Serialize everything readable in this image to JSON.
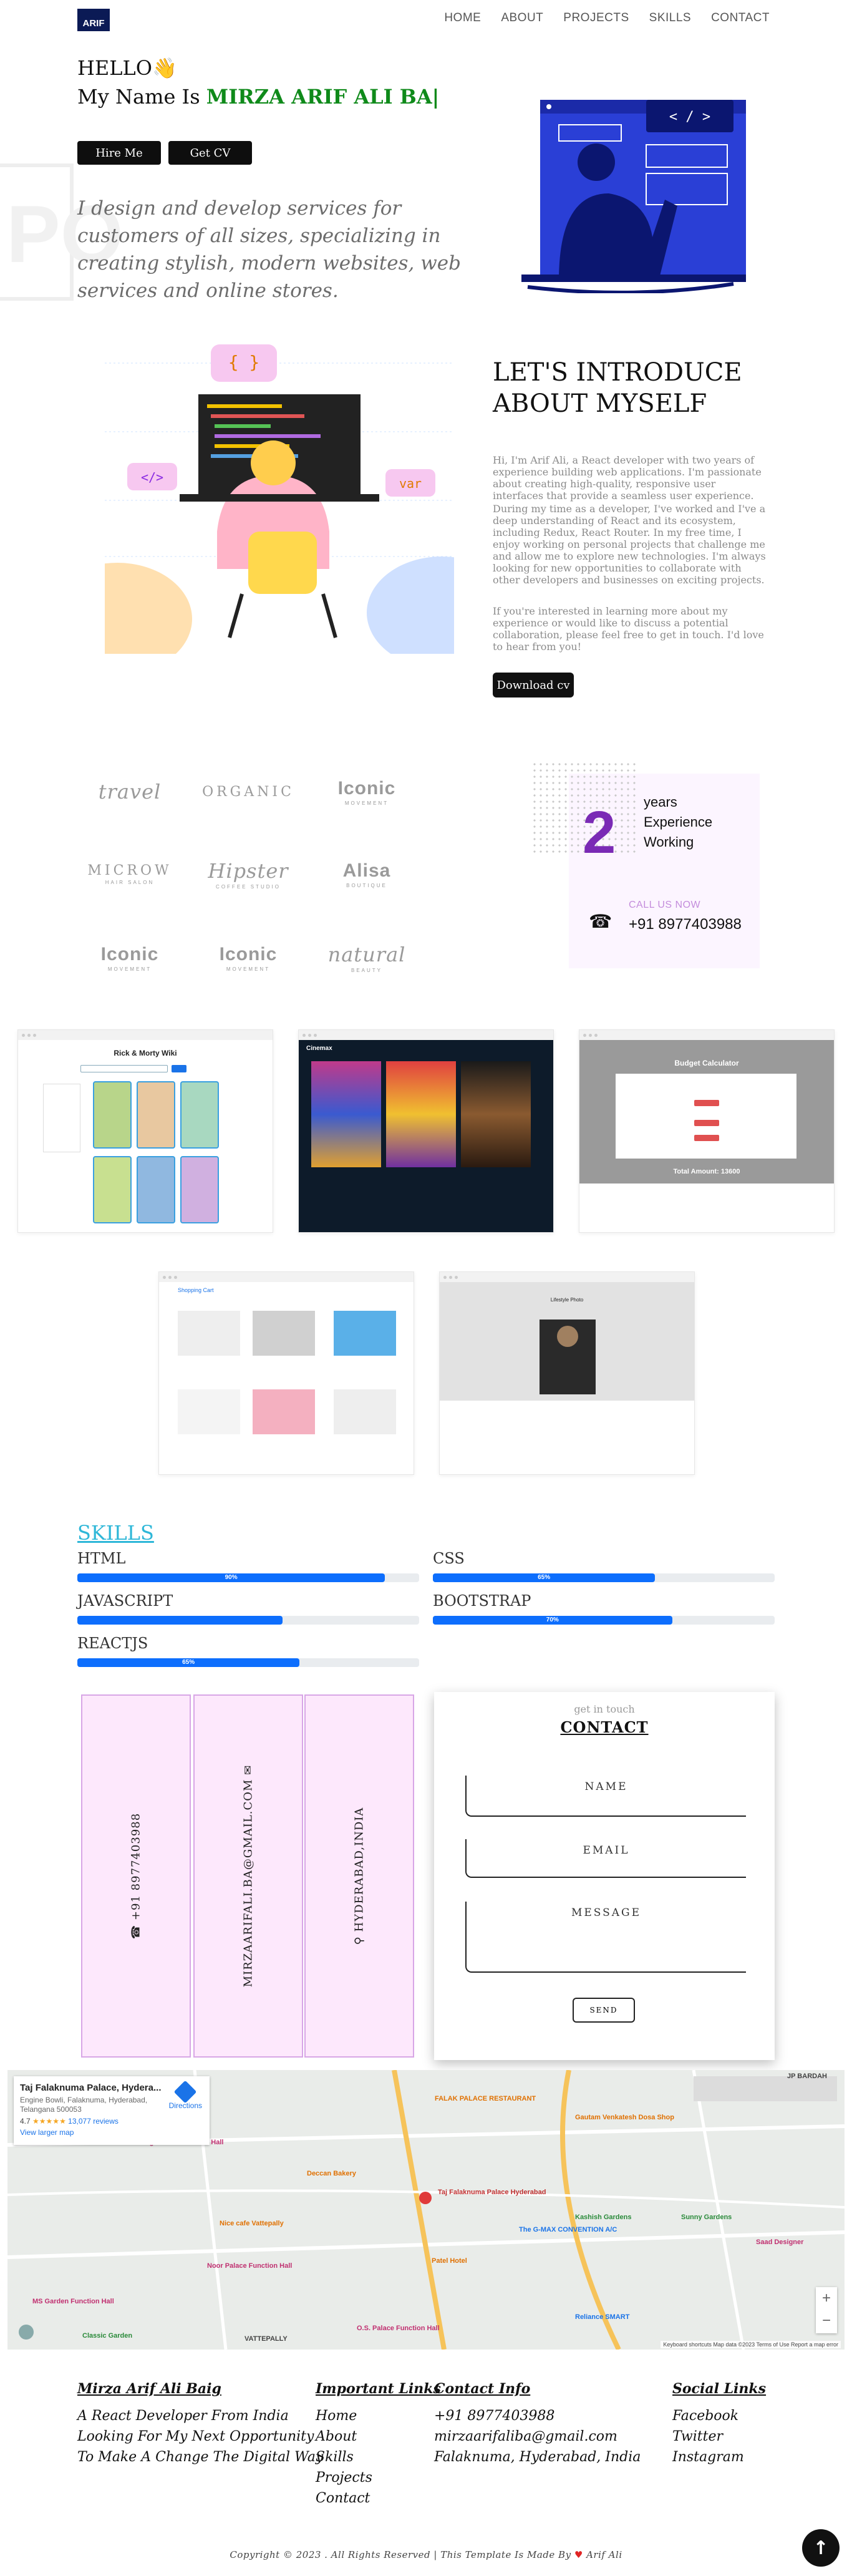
{
  "nav": {
    "logo": "ARIF",
    "links": [
      "HOME",
      "ABOUT",
      "PROJECTS",
      "SKILLS",
      "CONTACT"
    ]
  },
  "hero": {
    "hello": "HELLO",
    "name_prefix": "My Name Is ",
    "name": "MIRZA ARIF ALI BA|",
    "hire_button": "Hire Me",
    "cv_button": "Get CV",
    "ghost_text": "PO",
    "description": "I design and develop services for customers of all sizes, specializing in creating stylish, modern websites, web services and online stores.",
    "art_code": "< / >"
  },
  "about": {
    "title": "LET'S INTRODUCE ABOUT MYSELF",
    "p1": "Hi, I'm Arif Ali, a React developer with two years of experience building web applications. I'm passionate about creating high-quality, responsive user interfaces that provide a seamless user experience.",
    "p2": "During my time as a developer, I've worked and I've a deep understanding of React and its ecosystem, including Redux, React Router. In my free time, I enjoy working on personal projects that challenge me and allow me to explore new technologies. I'm always looking for new opportunities to collaborate with other developers and businesses on exciting projects.",
    "p3": "If you're interested in learning more about my experience or would like to discuss a potential collaboration, please feel free to get in touch. I'd love to hear from you!",
    "button": "Download cv",
    "art_tags": [
      "{ }",
      "</>",
      "var"
    ]
  },
  "brands": [
    {
      "name": "travel",
      "sub": ""
    },
    {
      "name": "ORGANIC",
      "sub": ""
    },
    {
      "name": "Iconic",
      "sub": "MOVEMENT"
    },
    {
      "name": "MICROW",
      "sub": "HAIR SALON"
    },
    {
      "name": "Hipster",
      "sub": "COFFEE STUDIO"
    },
    {
      "name": "Alisa",
      "sub": "BOUTIQUE"
    },
    {
      "name": "Iconic",
      "sub": "MOVEMENT"
    },
    {
      "name": "Iconic",
      "sub": "MOVEMENT"
    },
    {
      "name": "natural",
      "sub": "BEAUTY"
    }
  ],
  "experience": {
    "number": "2",
    "label_lines": [
      "years",
      "Experience",
      "Working"
    ],
    "call_label": "CALL US NOW",
    "phone": "+91 8977403988"
  },
  "projects": [
    {
      "title": "Rick & Morty Wiki"
    },
    {
      "title": "Cinemax"
    },
    {
      "title": "Budget Calculator",
      "total": "Total Amount: 13600"
    },
    {
      "title": "Shopping Cart"
    },
    {
      "title": "Lifestyle Photo"
    }
  ],
  "skills": {
    "title": "SKILLS",
    "items": [
      {
        "name": "HTML",
        "percent": 90,
        "label": "90%"
      },
      {
        "name": "CSS",
        "percent": 65,
        "label": "65%"
      },
      {
        "name": "JAVASCRIPT",
        "percent": 60,
        "label": ""
      },
      {
        "name": "BOOTSTRAP",
        "percent": 70,
        "label": "70%"
      },
      {
        "name": "REACTJS",
        "percent": 65,
        "label": "65%"
      }
    ]
  },
  "contact_info": {
    "phone": "+91 8977403988",
    "email": "MIRZAARIFALI.BA@GMAIL.COM",
    "city": "HYDERABAD,INDIA"
  },
  "contact_form": {
    "small": "get in touch",
    "title": "CONTACT",
    "name_label": "NAME",
    "email_label": "EMAIL",
    "message_label": "MESSAGE",
    "send": "SEND"
  },
  "map": {
    "place": "Taj Falaknuma Palace, Hydera...",
    "address": "Engine Bowli, Falaknuma, Hyderabad, Telangana 500053",
    "rating": "4.7",
    "stars": "★★★★★",
    "reviews": "13,077 reviews",
    "larger": "View larger map",
    "directions": "Directions",
    "labels": [
      "FALAK PALACE RESTAURANT",
      "Taj Falaknuma Palace Hyderabad",
      "Gautam Venkatesh Dosa Shop",
      "King's Pride Function Hall",
      "Deccan Bakery",
      "Nice cafe Vattepally",
      "Patel Hotel",
      "Noor Palace Function Hall",
      "The G-MAX CONVENTION A/C",
      "Kashish Gardens",
      "Sunny Gardens",
      "Saad Designer",
      "MS Garden Function Hall",
      "Classic Garden",
      "O.S. Palace Function Hall",
      "Reliance SMART",
      "VATTEPALLY",
      "JP BARDAH"
    ],
    "footer": "Keyboard shortcuts   Map data ©2023   Terms of Use   Report a map error"
  },
  "footer": {
    "name": "Mirza Arif Ali Baig",
    "tagline": [
      "A React Developer From India",
      "Looking For My Next Opportunity",
      "To Make A Change The Digital Way"
    ],
    "links_title": "Important Links",
    "links": [
      "Home",
      "About",
      "Skills",
      "Projects",
      "Contact"
    ],
    "info_title": "Contact Info",
    "info": [
      "+91 8977403988",
      "mirzaarifaliba@gmail.com",
      "Falaknuma, Hyderabad, India"
    ],
    "social_title": "Social Links",
    "social": [
      "Facebook",
      "Twitter",
      "Instagram"
    ],
    "copyright_a": "Copyright © 2023 . All Rights Reserved | This Template Is Made By",
    "copyright_b": "Arif Ali",
    "to_top": "↑"
  },
  "colors": {
    "accent": "#0d6efd",
    "name_green": "#0f8a1a",
    "purple": "#7a2ab5",
    "skills": "#2eb7d8"
  }
}
